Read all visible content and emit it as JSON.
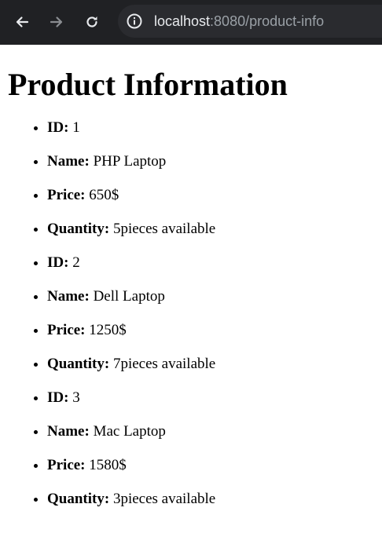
{
  "browser": {
    "url_host": "localhost",
    "url_rest": ":8080/product-info",
    "icons": [
      "back-arrow-icon",
      "forward-arrow-icon",
      "reload-icon",
      "site-info-icon"
    ]
  },
  "page": {
    "title": "Product Information"
  },
  "labels": {
    "id": "ID:",
    "name": "Name:",
    "price": "Price:",
    "quantity": "Quantity:"
  },
  "products": [
    {
      "id": "1",
      "name": "PHP Laptop",
      "price": "650$",
      "quantity": "5pieces available"
    },
    {
      "id": "2",
      "name": "Dell Laptop",
      "price": "1250$",
      "quantity": "7pieces available"
    },
    {
      "id": "3",
      "name": "Mac Laptop",
      "price": "1580$",
      "quantity": "3pieces available"
    }
  ]
}
